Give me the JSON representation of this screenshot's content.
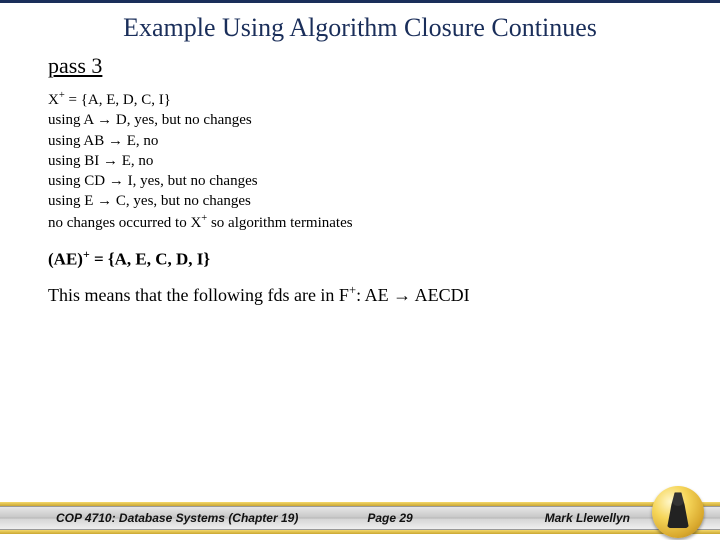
{
  "title": "Example Using Algorithm Closure Continues",
  "pass_label": "pass 3",
  "steps": {
    "line1_pre": "X",
    "line1_post": " = {A, E, D, C, I}",
    "line2": "using A → D, yes, but no changes",
    "line3": "using AB → E, no",
    "line4": "using BI → E, no",
    "line5": "using CD → I, yes, but no changes",
    "line6": "using E → C, yes, but no changes",
    "line7_pre": "no changes occurred to X",
    "line7_post": " so algorithm terminates"
  },
  "result": {
    "pre": "(AE)",
    "post": " = {A, E, C, D, I}"
  },
  "meaning": {
    "pre": "This means that the following fds are in F",
    "post": ":  AE → AECDI"
  },
  "superscript": "+",
  "footer": {
    "left": "COP 4710: Database Systems  (Chapter 19)",
    "center": "Page 29",
    "right": "Mark Llewellyn"
  }
}
